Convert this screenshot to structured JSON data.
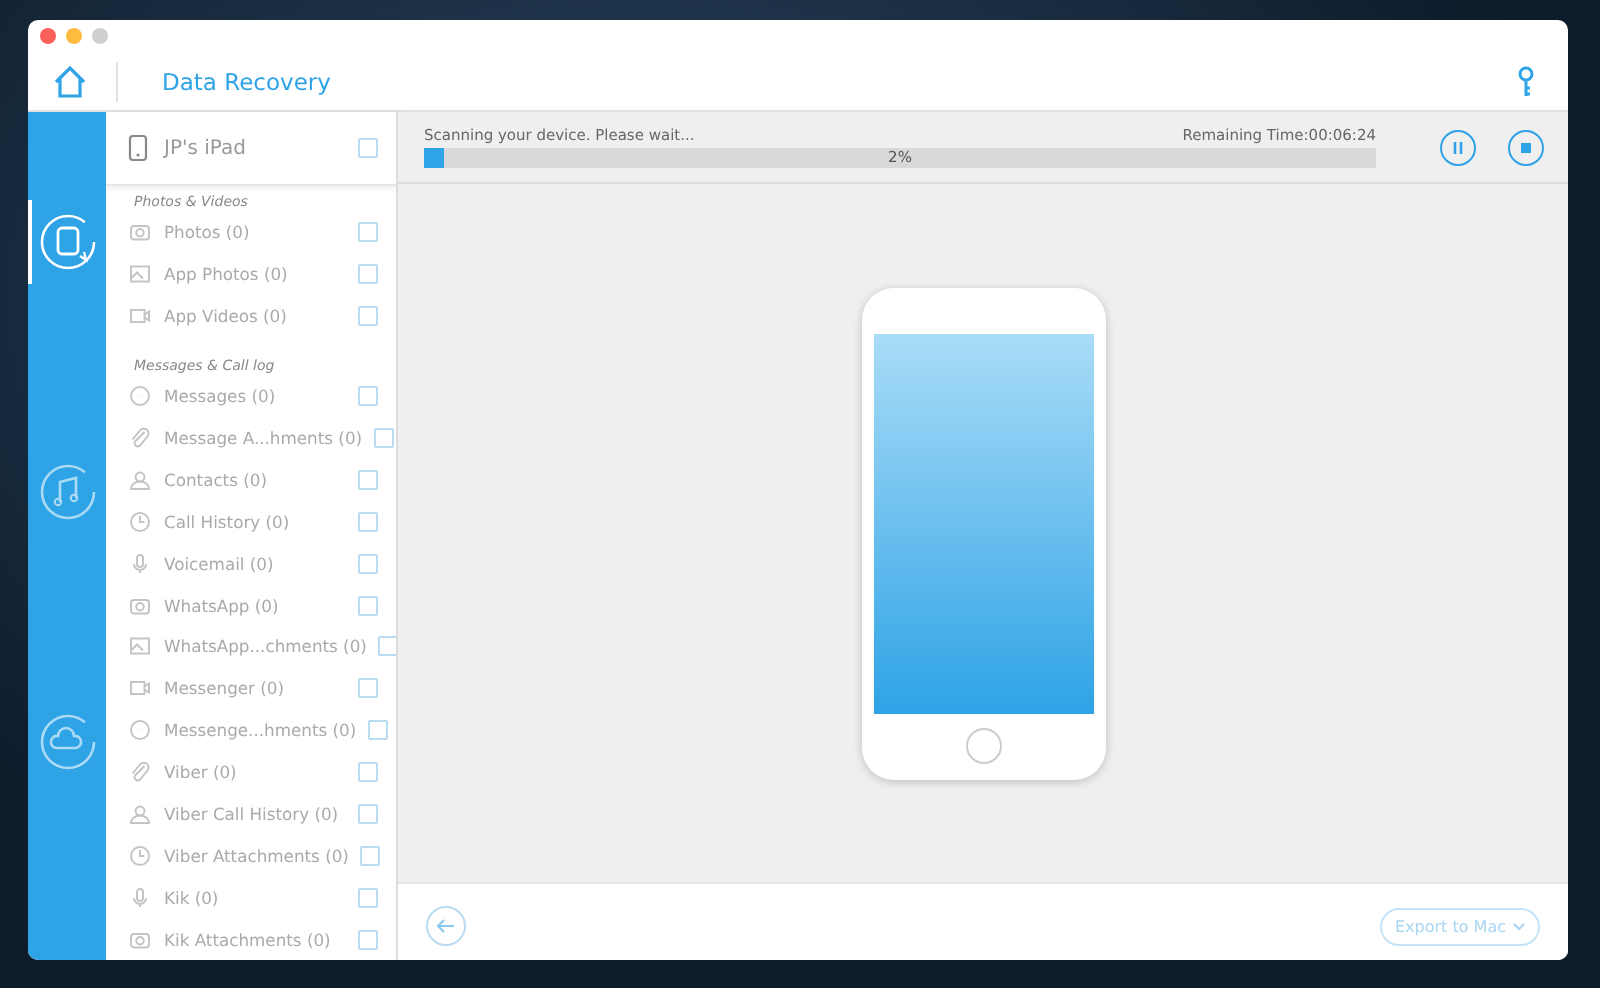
{
  "window": {
    "title": "Data Recovery"
  },
  "rail": [
    {
      "selected": true
    },
    {
      "selected": false
    },
    {
      "selected": false
    }
  ],
  "device": {
    "name": "JP's iPad",
    "checked": false
  },
  "sections": [
    {
      "title": "Photos & Videos",
      "items": [
        {
          "label": "Photos (0)",
          "checked": false
        },
        {
          "label": "App Photos (0)",
          "checked": false
        },
        {
          "label": "App Videos (0)",
          "checked": false
        }
      ]
    },
    {
      "title": "Messages & Call log",
      "items": [
        {
          "label": "Messages (0)",
          "checked": false
        },
        {
          "label": "Message A...hments (0)",
          "checked": false
        },
        {
          "label": "Contacts (0)",
          "checked": false
        },
        {
          "label": "Call History (0)",
          "checked": false
        },
        {
          "label": "Voicemail (0)",
          "checked": false
        },
        {
          "label": "WhatsApp (0)",
          "checked": false
        },
        {
          "label": "WhatsApp...chments (0)",
          "checked": false
        },
        {
          "label": "Messenger (0)",
          "checked": false
        },
        {
          "label": "Messenge...hments (0)",
          "checked": false
        },
        {
          "label": "Viber (0)",
          "checked": false
        },
        {
          "label": "Viber Call History (0)",
          "checked": false
        },
        {
          "label": "Viber Attachments (0)",
          "checked": false
        },
        {
          "label": "Kik (0)",
          "checked": false
        },
        {
          "label": "Kik Attachments (0)",
          "checked": false
        }
      ]
    }
  ],
  "scan": {
    "status": "Scanning your device. Please wait...",
    "remaining": "Remaining Time:00:06:24",
    "level": 0.02,
    "percent": "2%"
  },
  "export_button": {
    "label": "Export to Mac",
    "disabled": true
  }
}
